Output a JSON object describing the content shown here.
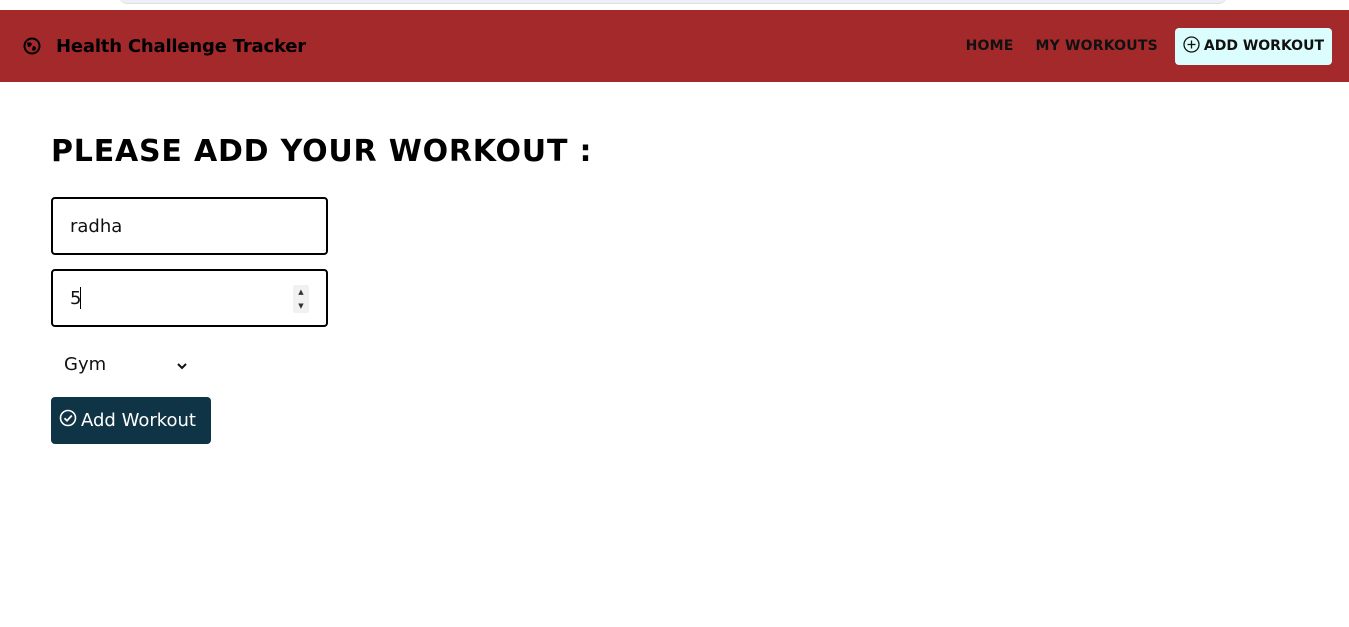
{
  "navbar": {
    "brand_icon": "globe-icon",
    "brand_title": "Health Challenge Tracker",
    "background_color": "#a4292b",
    "links": [
      {
        "label": "HOME"
      },
      {
        "label": "MY WORKOUTS"
      }
    ],
    "cta": {
      "icon": "plus-circle-icon",
      "label": "ADD WORKOUT",
      "background_color": "#dcfdfd"
    }
  },
  "form": {
    "title": "PLEASE ADD YOUR WORKOUT :",
    "name_value": "radha",
    "minutes_value": "5",
    "workout_type_selected": "Gym",
    "submit_icon": "check-circle-icon",
    "submit_label": "Add Workout",
    "submit_color": "#0f3445"
  }
}
